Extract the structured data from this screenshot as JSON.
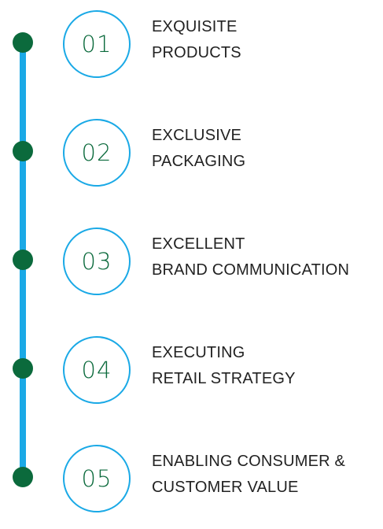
{
  "colors": {
    "rail": "#1aa9e6",
    "dot": "#0b6a3c",
    "circle_border": "#1aa9e6",
    "number_text": "#0b6a3c",
    "label_text": "#222222"
  },
  "steps": [
    {
      "number": "01",
      "line1": "EXQUISITE",
      "line2": "PRODUCTS"
    },
    {
      "number": "02",
      "line1": "EXCLUSIVE",
      "line2": "PACKAGING"
    },
    {
      "number": "03",
      "line1": "EXCELLENT",
      "line2": "BRAND COMMUNICATION"
    },
    {
      "number": "04",
      "line1": "EXECUTING",
      "line2": "RETAIL STRATEGY"
    },
    {
      "number": "05",
      "line1": "ENABLING CONSUMER &",
      "line2": "CUSTOMER VALUE"
    }
  ]
}
